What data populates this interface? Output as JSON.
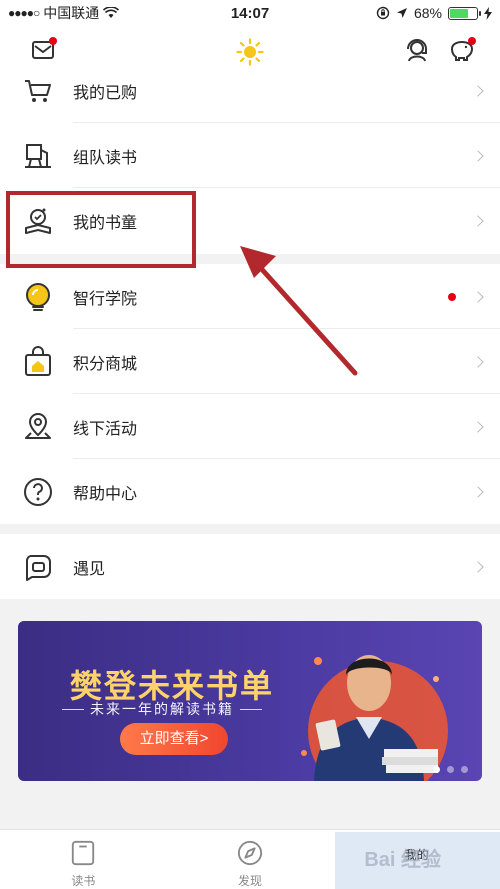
{
  "status_bar": {
    "signal_dots": "●●●●○",
    "carrier": "中国联通",
    "time": "14:07",
    "battery_percent": "68%",
    "battery_level": 0.68
  },
  "header": {
    "left_icon": "mail-icon",
    "center_icon": "sun-icon",
    "right_icons": [
      "customer-service-icon",
      "piggy-bank-icon"
    ]
  },
  "menu_top": [
    {
      "name": "cart",
      "label": "我的已购",
      "icon": "cart-icon"
    },
    {
      "name": "team-reading",
      "label": "组队读书",
      "icon": "book-stand-icon"
    },
    {
      "name": "book-kid",
      "label": "我的书童",
      "icon": "book-kid-icon"
    }
  ],
  "menu_middle": [
    {
      "name": "academy",
      "label": "智行学院",
      "icon": "lightbulb-icon",
      "badge": true
    },
    {
      "name": "points-mall",
      "label": "积分商城",
      "icon": "shopping-bag-icon"
    },
    {
      "name": "offline-events",
      "label": "线下活动",
      "icon": "location-pin-icon"
    },
    {
      "name": "help-center",
      "label": "帮助中心",
      "icon": "help-icon"
    }
  ],
  "menu_bottom": [
    {
      "name": "meet",
      "label": "遇见",
      "icon": "chat-bubble-icon"
    }
  ],
  "banner": {
    "title": "樊登未来书单",
    "subtitle": "未来一年的解读书籍",
    "button": "立即查看>",
    "pages": 3,
    "active_page": 1
  },
  "tabbar": {
    "tabs": [
      {
        "name": "read",
        "label": "读书",
        "icon": "book-icon"
      },
      {
        "name": "discover",
        "label": "发现",
        "icon": "compass-icon"
      },
      {
        "name": "mine",
        "label": "我的",
        "icon": "profile-icon",
        "active": true
      }
    ],
    "watermark": "Bai 经验"
  },
  "colors": {
    "accent_yellow": "#f5c518",
    "highlight_red": "#b3282d",
    "badge_red": "#e60012",
    "banner_purple": "#4a3aa0"
  }
}
